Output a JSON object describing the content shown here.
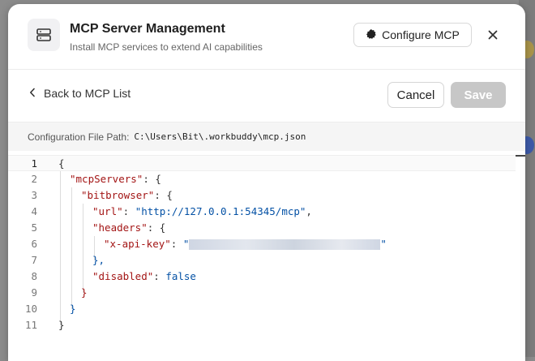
{
  "header": {
    "title": "MCP Server Management",
    "subtitle": "Install MCP services to extend AI capabilities",
    "configure_label": "Configure MCP",
    "icon": "server-icon"
  },
  "toolbar": {
    "back_label": "Back to MCP List",
    "cancel_label": "Cancel",
    "save_label": "Save"
  },
  "config_path": {
    "label": "Configuration File Path:",
    "value": "C:\\Users\\Bit\\.workbuddy\\mcp.json"
  },
  "editor": {
    "line_numbers": [
      "1",
      "2",
      "3",
      "4",
      "5",
      "6",
      "7",
      "8",
      "9",
      "10",
      "11"
    ],
    "tokens": {
      "open_brace": "{",
      "mcp_servers_key": "\"mcpServers\"",
      "bitbrowser_key": "\"bitbrowser\"",
      "url_key": "\"url\"",
      "url_value": "\"http://127.0.0.1:54345/mcp\"",
      "headers_key": "\"headers\"",
      "api_key_key": "\"x-api-key\"",
      "api_key_open_quote": "\"",
      "api_key_close_quote": "\"",
      "disabled_key": "\"disabled\"",
      "disabled_value": "false",
      "colon_brace": ": {",
      "colon": ": ",
      "comma": ",",
      "close_brace_comma": "},",
      "close_brace": "}"
    }
  },
  "colors": {
    "key": "#a31515",
    "string": "#0451a5",
    "save_disabled": "#c7c7c7"
  }
}
